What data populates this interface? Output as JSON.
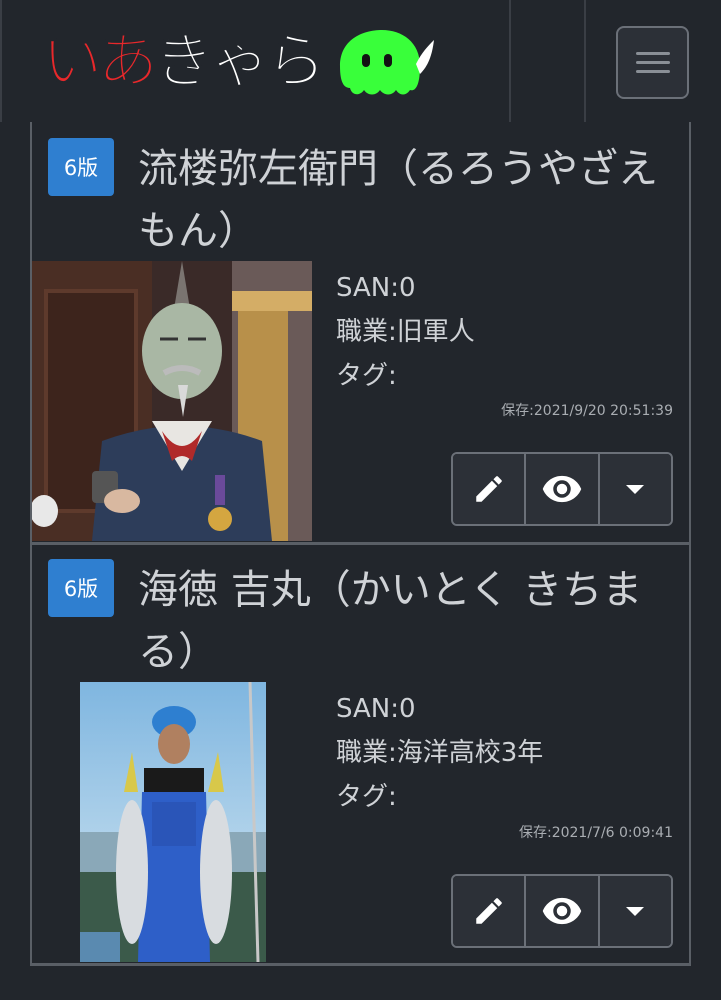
{
  "header": {
    "logo_chars": [
      {
        "char": "い",
        "color": "#e8282b"
      },
      {
        "char": "あ",
        "color": "#e8282b"
      },
      {
        "char": "き",
        "color": "#ffffff"
      },
      {
        "char": "ゃ",
        "color": "#ffffff"
      },
      {
        "char": "ら",
        "color": "#ffffff"
      }
    ],
    "mascot_color": "#39ff3a",
    "menu_icon": "hamburger-icon"
  },
  "characters": [
    {
      "edition": "6版",
      "name": "流楼弥左衛門（るろうやざえもん）",
      "san": "SAN:0",
      "occupation": "職業:旧軍人",
      "tags": "タグ:",
      "saved": "保存:2021/9/20 20:51:39",
      "actions": [
        "pencil-icon",
        "eye-icon",
        "caret-down-icon"
      ]
    },
    {
      "edition": "6版",
      "name": "海徳 吉丸（かいとく きちまる）",
      "san": "SAN:0",
      "occupation": "職業:海洋高校3年",
      "tags": "タグ:",
      "saved": "保存:2021/7/6 0:09:41",
      "actions": [
        "pencil-icon",
        "eye-icon",
        "caret-down-icon"
      ]
    }
  ],
  "colors": {
    "badge": "#2f7fd0",
    "background": "#22262c"
  }
}
